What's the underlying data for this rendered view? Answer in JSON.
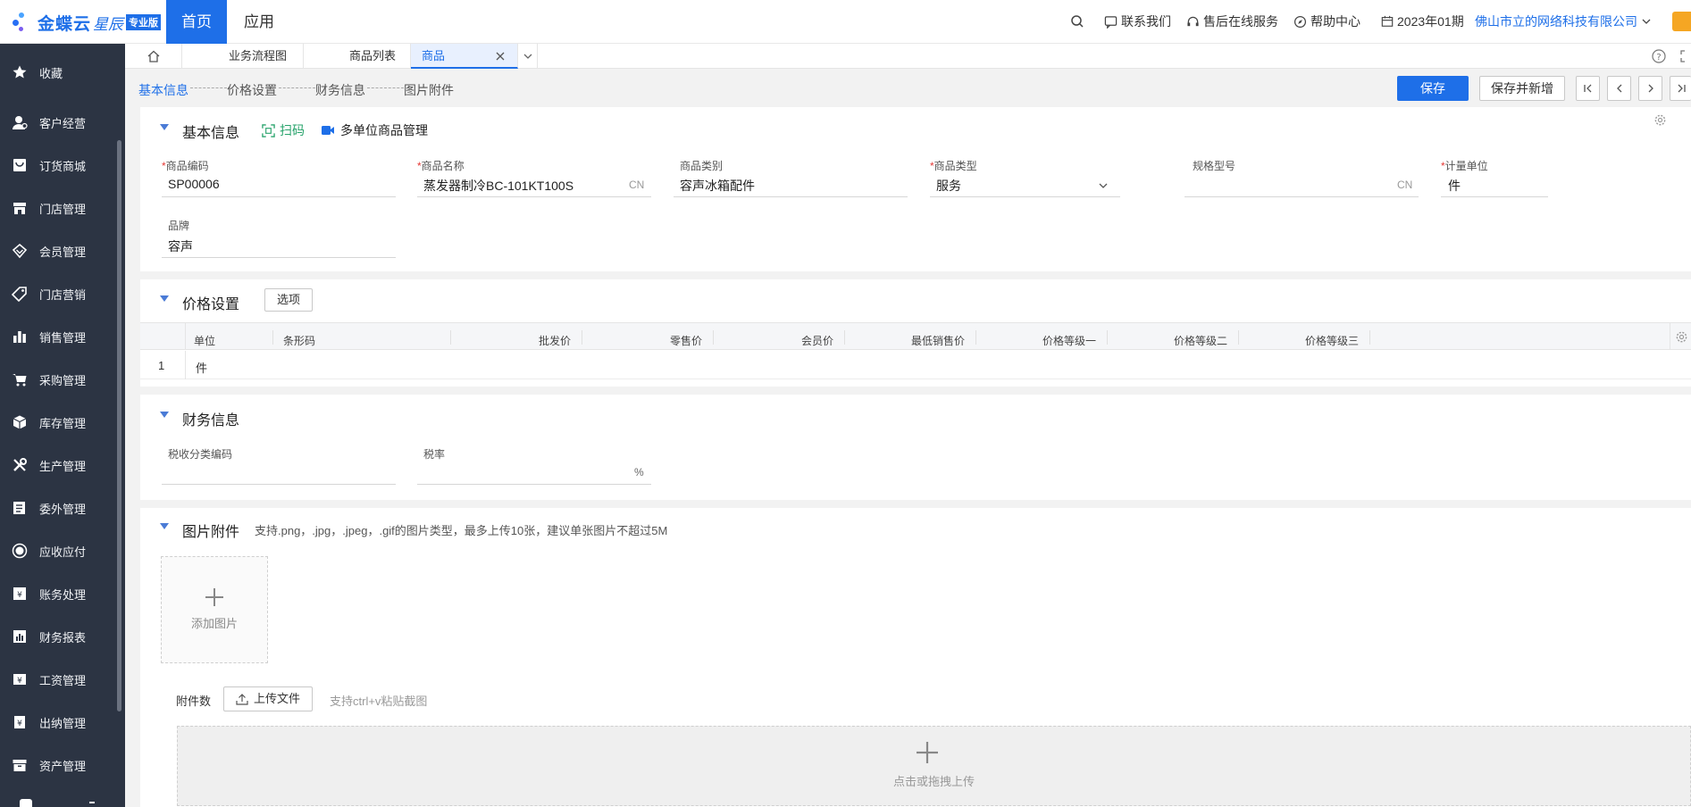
{
  "app": {
    "brand": "金蝶云",
    "brand2": "星辰",
    "edition": "专业版"
  },
  "topnav": {
    "home": "首页",
    "apps": "应用",
    "contact": "联系我们",
    "service": "售后在线服务",
    "help": "帮助中心",
    "period": "2023年01期",
    "company": "佛山市立的网络科技有限公司"
  },
  "sidebar": {
    "items": [
      {
        "label": "收藏",
        "icon": "star-icon"
      },
      {
        "label": "客户经营",
        "icon": "customer-icon"
      },
      {
        "label": "订货商城",
        "icon": "mall-icon"
      },
      {
        "label": "门店管理",
        "icon": "store-icon"
      },
      {
        "label": "会员管理",
        "icon": "member-icon"
      },
      {
        "label": "门店营销",
        "icon": "tag-icon"
      },
      {
        "label": "销售管理",
        "icon": "sales-chart-icon"
      },
      {
        "label": "采购管理",
        "icon": "cart-icon"
      },
      {
        "label": "库存管理",
        "icon": "box-icon"
      },
      {
        "label": "生产管理",
        "icon": "tools-icon"
      },
      {
        "label": "委外管理",
        "icon": "outsource-icon"
      },
      {
        "label": "应收应付",
        "icon": "coin-icon"
      },
      {
        "label": "账务处理",
        "icon": "ledger-icon"
      },
      {
        "label": "财务报表",
        "icon": "report-icon"
      },
      {
        "label": "工资管理",
        "icon": "salary-icon"
      },
      {
        "label": "出纳管理",
        "icon": "cashier-icon"
      },
      {
        "label": "资产管理",
        "icon": "asset-icon"
      }
    ]
  },
  "tabs": [
    {
      "label": "业务流程图"
    },
    {
      "label": "商品列表"
    },
    {
      "label": "商品"
    }
  ],
  "steps": [
    "基本信息",
    "价格设置",
    "财务信息",
    "图片附件"
  ],
  "toolbar": {
    "save": "保存",
    "save_new": "保存并新增"
  },
  "basic": {
    "title": "基本信息",
    "scan": "扫码",
    "multi_unit": "多单位商品管理",
    "fields": {
      "code": {
        "label": "商品编码",
        "value": "SP00006"
      },
      "name": {
        "label": "商品名称",
        "value": "蒸发器制冷BC-101KT100S",
        "suffix": "CN"
      },
      "category": {
        "label": "商品类别",
        "value": "容声冰箱配件"
      },
      "type": {
        "label": "商品类型",
        "value": "服务"
      },
      "spec": {
        "label": "规格型号",
        "value": "",
        "suffix": "CN"
      },
      "unit": {
        "label": "计量单位",
        "value": "件"
      },
      "brand": {
        "label": "品牌",
        "value": "容声"
      }
    }
  },
  "price": {
    "title": "价格设置",
    "options_button": "选项",
    "columns": [
      "单位",
      "条形码",
      "批发价",
      "零售价",
      "会员价",
      "最低销售价",
      "价格等级一",
      "价格等级二",
      "价格等级三"
    ],
    "rows": [
      {
        "index": "1",
        "unit": "件"
      }
    ]
  },
  "finance": {
    "title": "财务信息",
    "tax_code_label": "税收分类编码",
    "tax_rate_label": "税率",
    "tax_rate_unit": "%"
  },
  "attach": {
    "title": "图片附件",
    "hint": "支持.png，.jpg，.jpeg，.gif的图片类型，最多上传10张，建议单张图片不超过5M",
    "add_image": "添加图片",
    "count_label": "附件数",
    "upload_button": "上传文件",
    "paste_hint": "支持ctrl+v粘贴截图",
    "drop_hint": "点击或拖拽上传"
  }
}
